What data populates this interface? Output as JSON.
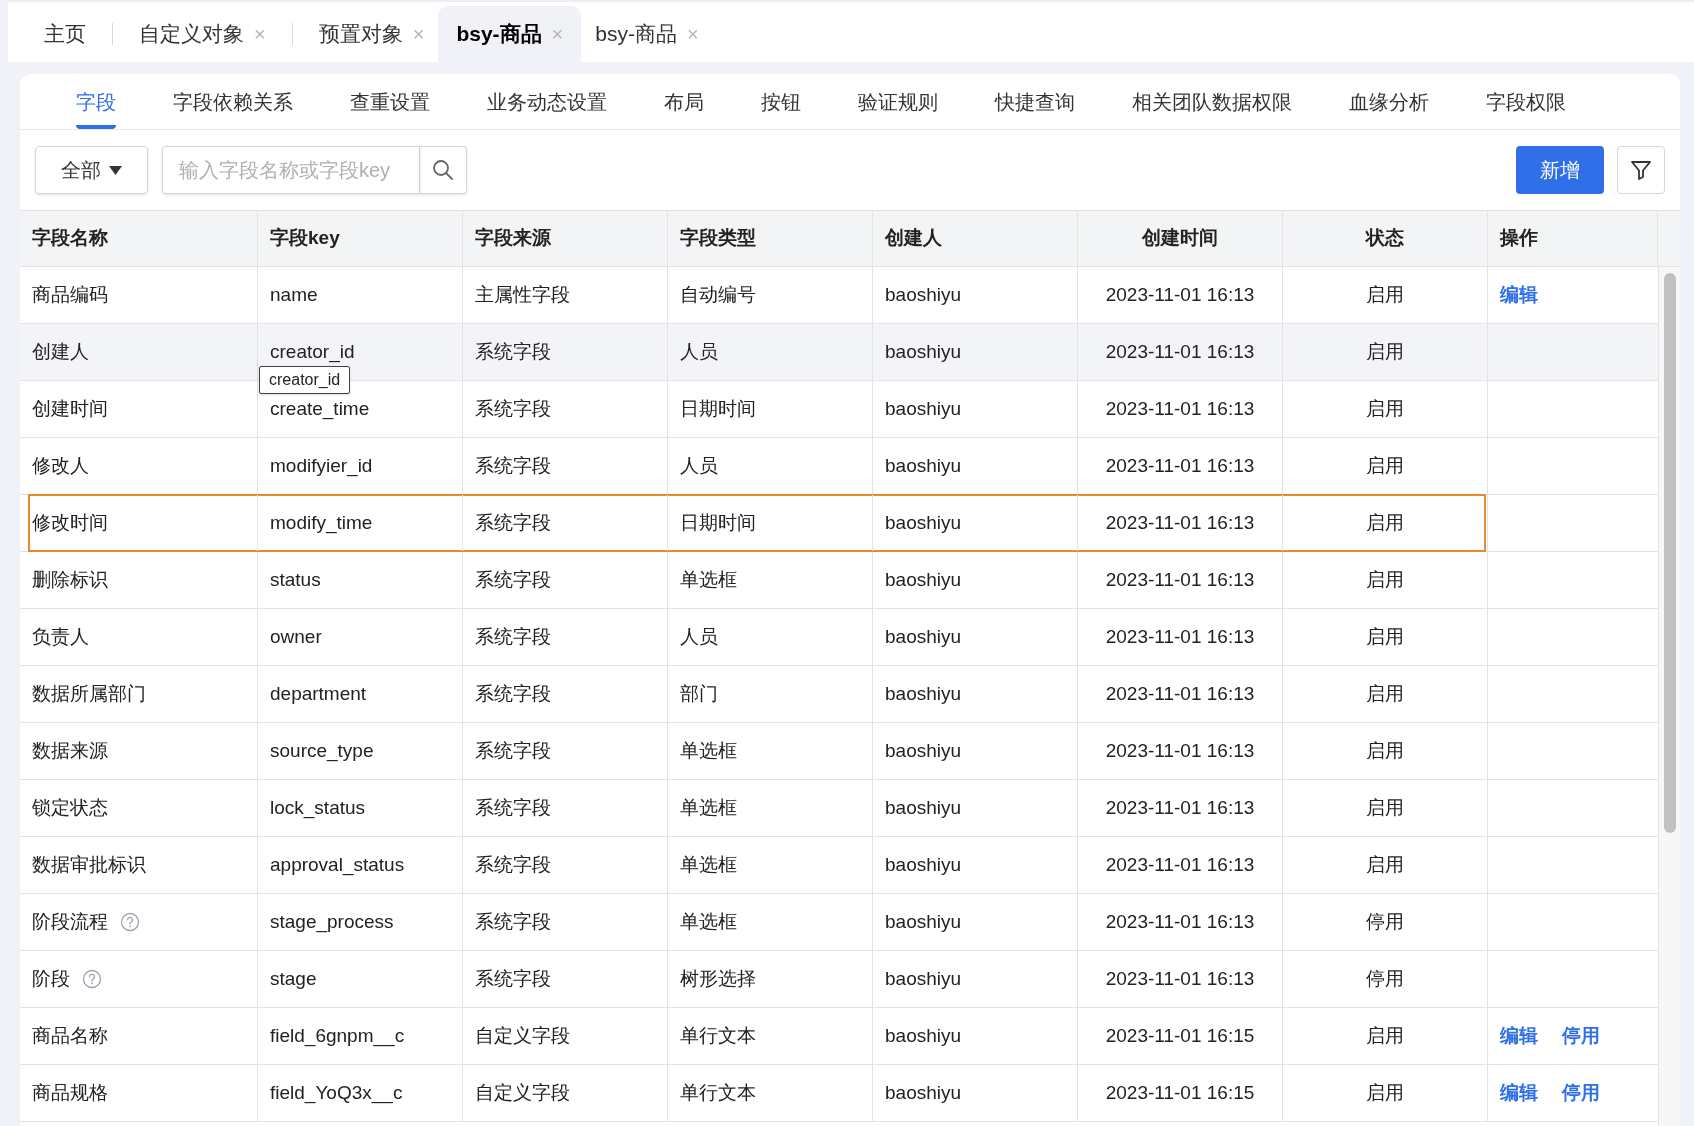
{
  "top_tabs": [
    {
      "label": "主页",
      "closable": false,
      "selected": false
    },
    {
      "label": "自定义对象",
      "closable": true,
      "selected": false
    },
    {
      "label": "预置对象",
      "closable": true,
      "selected": false
    },
    {
      "label": "bsy-商品",
      "closable": true,
      "selected": true
    },
    {
      "label": "bsy-商品",
      "closable": true,
      "selected": false
    }
  ],
  "close_glyph": "×",
  "sub_tabs": [
    {
      "label": "字段",
      "selected": true
    },
    {
      "label": "字段依赖关系",
      "selected": false
    },
    {
      "label": "查重设置",
      "selected": false
    },
    {
      "label": "业务动态设置",
      "selected": false
    },
    {
      "label": "布局",
      "selected": false
    },
    {
      "label": "按钮",
      "selected": false
    },
    {
      "label": "验证规则",
      "selected": false
    },
    {
      "label": "快捷查询",
      "selected": false
    },
    {
      "label": "相关团队数据权限",
      "selected": false
    },
    {
      "label": "血缘分析",
      "selected": false
    },
    {
      "label": "字段权限",
      "selected": false
    }
  ],
  "toolbar": {
    "filter_dropdown": "全部",
    "search": {
      "placeholder": "输入字段名称或字段key"
    },
    "add_button": "新增"
  },
  "table": {
    "columns": [
      "字段名称",
      "字段key",
      "字段来源",
      "字段类型",
      "创建人",
      "创建时间",
      "状态",
      "操作"
    ],
    "rows": [
      {
        "name": "商品编码",
        "key": "name",
        "source": "主属性字段",
        "type": "自动编号",
        "creator": "baoshiyu",
        "created": "2023-11-01 16:13",
        "status": "启用",
        "help": false,
        "hovered": false,
        "focused": false,
        "actions": [
          "编辑"
        ]
      },
      {
        "name": "创建人",
        "key": "creator_id",
        "source": "系统字段",
        "type": "人员",
        "creator": "baoshiyu",
        "created": "2023-11-01 16:13",
        "status": "启用",
        "help": false,
        "hovered": true,
        "focused": false,
        "tooltip": "creator_id",
        "actions": []
      },
      {
        "name": "创建时间",
        "key": "create_time",
        "source": "系统字段",
        "type": "日期时间",
        "creator": "baoshiyu",
        "created": "2023-11-01 16:13",
        "status": "启用",
        "help": false,
        "hovered": false,
        "focused": false,
        "actions": []
      },
      {
        "name": "修改人",
        "key": "modifyier_id",
        "source": "系统字段",
        "type": "人员",
        "creator": "baoshiyu",
        "created": "2023-11-01 16:13",
        "status": "启用",
        "help": false,
        "hovered": false,
        "focused": false,
        "actions": []
      },
      {
        "name": "修改时间",
        "key": "modify_time",
        "source": "系统字段",
        "type": "日期时间",
        "creator": "baoshiyu",
        "created": "2023-11-01 16:13",
        "status": "启用",
        "help": false,
        "hovered": false,
        "focused": true,
        "actions": []
      },
      {
        "name": "删除标识",
        "key": "status",
        "source": "系统字段",
        "type": "单选框",
        "creator": "baoshiyu",
        "created": "2023-11-01 16:13",
        "status": "启用",
        "help": false,
        "hovered": false,
        "focused": false,
        "actions": []
      },
      {
        "name": "负责人",
        "key": "owner",
        "source": "系统字段",
        "type": "人员",
        "creator": "baoshiyu",
        "created": "2023-11-01 16:13",
        "status": "启用",
        "help": false,
        "hovered": false,
        "focused": false,
        "actions": []
      },
      {
        "name": "数据所属部门",
        "key": "department",
        "source": "系统字段",
        "type": "部门",
        "creator": "baoshiyu",
        "created": "2023-11-01 16:13",
        "status": "启用",
        "help": false,
        "hovered": false,
        "focused": false,
        "actions": []
      },
      {
        "name": "数据来源",
        "key": "source_type",
        "source": "系统字段",
        "type": "单选框",
        "creator": "baoshiyu",
        "created": "2023-11-01 16:13",
        "status": "启用",
        "help": false,
        "hovered": false,
        "focused": false,
        "actions": []
      },
      {
        "name": "锁定状态",
        "key": "lock_status",
        "source": "系统字段",
        "type": "单选框",
        "creator": "baoshiyu",
        "created": "2023-11-01 16:13",
        "status": "启用",
        "help": false,
        "hovered": false,
        "focused": false,
        "actions": []
      },
      {
        "name": "数据审批标识",
        "key": "approval_status",
        "source": "系统字段",
        "type": "单选框",
        "creator": "baoshiyu",
        "created": "2023-11-01 16:13",
        "status": "启用",
        "help": false,
        "hovered": false,
        "focused": false,
        "actions": []
      },
      {
        "name": "阶段流程",
        "key": "stage_process",
        "source": "系统字段",
        "type": "单选框",
        "creator": "baoshiyu",
        "created": "2023-11-01 16:13",
        "status": "停用",
        "help": true,
        "hovered": false,
        "focused": false,
        "actions": []
      },
      {
        "name": "阶段",
        "key": "stage",
        "source": "系统字段",
        "type": "树形选择",
        "creator": "baoshiyu",
        "created": "2023-11-01 16:13",
        "status": "停用",
        "help": true,
        "hovered": false,
        "focused": false,
        "actions": []
      },
      {
        "name": "商品名称",
        "key": "field_6gnpm__c",
        "source": "自定义字段",
        "type": "单行文本",
        "creator": "baoshiyu",
        "created": "2023-11-01 16:15",
        "status": "启用",
        "help": false,
        "hovered": false,
        "focused": false,
        "actions": [
          "编辑",
          "停用"
        ]
      },
      {
        "name": "商品规格",
        "key": "field_YoQ3x__c",
        "source": "自定义字段",
        "type": "单行文本",
        "creator": "baoshiyu",
        "created": "2023-11-01 16:15",
        "status": "启用",
        "help": false,
        "hovered": false,
        "focused": false,
        "actions": [
          "编辑",
          "停用"
        ]
      }
    ]
  }
}
